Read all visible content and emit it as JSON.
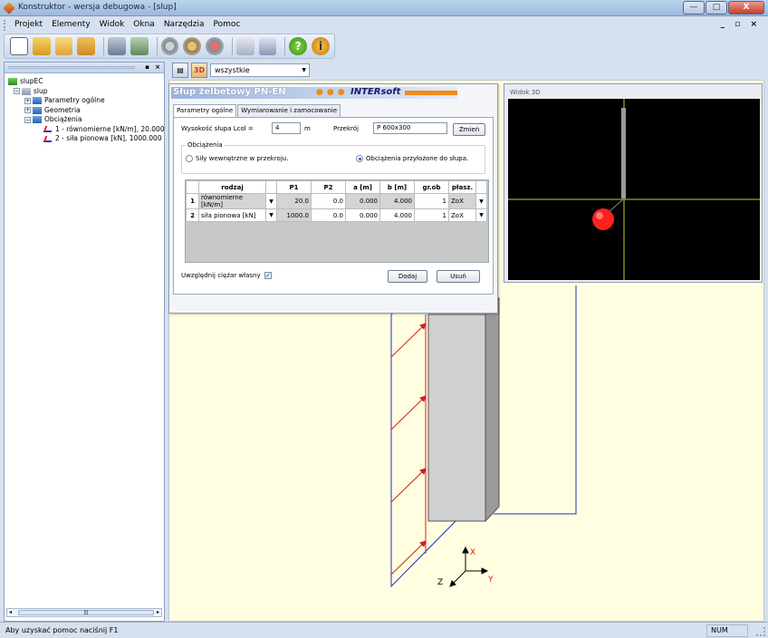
{
  "window": {
    "title": "Konstruktor - wersja debugowa - [slup]",
    "minimize": "—",
    "maximize": "□",
    "close": "X"
  },
  "menu": {
    "items": [
      "Projekt",
      "Elementy",
      "Widok",
      "Okna",
      "Narzędzia",
      "Pomoc"
    ],
    "mdi_controls": "_ ▫ ×"
  },
  "toolbar": {
    "icons": [
      "new-icon",
      "open-icon",
      "folder-icon",
      "save-icon",
      "export-icon",
      "import-icon",
      "settings-icon",
      "settings-alt-icon",
      "tools-icon",
      "calculator-icon",
      "report-icon",
      "help-icon",
      "info-icon"
    ],
    "help_glyph": "?",
    "info_glyph": "i"
  },
  "tree": {
    "root": "slupEC",
    "column": "slup",
    "nodes": [
      "Parametry ogólne",
      "Geometria",
      "Obciążenia"
    ],
    "loads": [
      "1 - równomierne [kN/m], 20.000",
      "2 - siła pionowa [kN], 1000.000"
    ]
  },
  "viewbar": {
    "btn_3d": "3D",
    "filter": "wszystkie"
  },
  "dialog": {
    "title": "Słup żelbetowy PN-EN",
    "brand": "INTERsoft",
    "tabs": [
      "Parametry ogólne",
      "Wymiarowanie i zamocowanie"
    ],
    "height_label": "Wysokość słupa Lcol =",
    "height_value": "4",
    "height_unit": "m",
    "section_label": "Przekrój",
    "section_value": "P 600x300",
    "change_button": "Zmień",
    "loads_group": "Obciążenia",
    "radio_internal": "Siły wewnętrzne w przekroju.",
    "radio_applied": "Obciążenia przyłożone do słupa.",
    "table": {
      "headers": [
        "",
        "rodzaj",
        "",
        "P1",
        "P2",
        "a [m]",
        "b [m]",
        "gr.ob",
        "płasz.",
        ""
      ],
      "rows": [
        {
          "n": "1",
          "rodzaj": "równomierne [kN/m]",
          "p1": "20.0",
          "p2": "0.0",
          "a": "0.000",
          "b": "4.000",
          "grob": "1",
          "plasz": "ZoX"
        },
        {
          "n": "2",
          "rodzaj": "siła pionowa [kN]",
          "p1": "1000.0",
          "p2": "0.0",
          "a": "0.000",
          "b": "4.000",
          "grob": "1",
          "plasz": "ZoX"
        }
      ]
    },
    "selfweight_label": "Uwzględnij ciężar własny",
    "add_button": "Dodaj",
    "remove_button": "Usuń"
  },
  "view3d": {
    "title": "Widok 3D",
    "background": "#000000",
    "marker_color": "#ff2020",
    "axis_color": "#cccc33"
  },
  "axes": {
    "x": "X",
    "y": "Y",
    "z": "Z"
  },
  "statusbar": {
    "message": "Aby uzyskać pomoc naciśnij F1",
    "num": "NUM"
  },
  "colors": {
    "workarea": "#fffee0",
    "load_arrow": "#d02020",
    "frame_line": "#2030c0"
  }
}
